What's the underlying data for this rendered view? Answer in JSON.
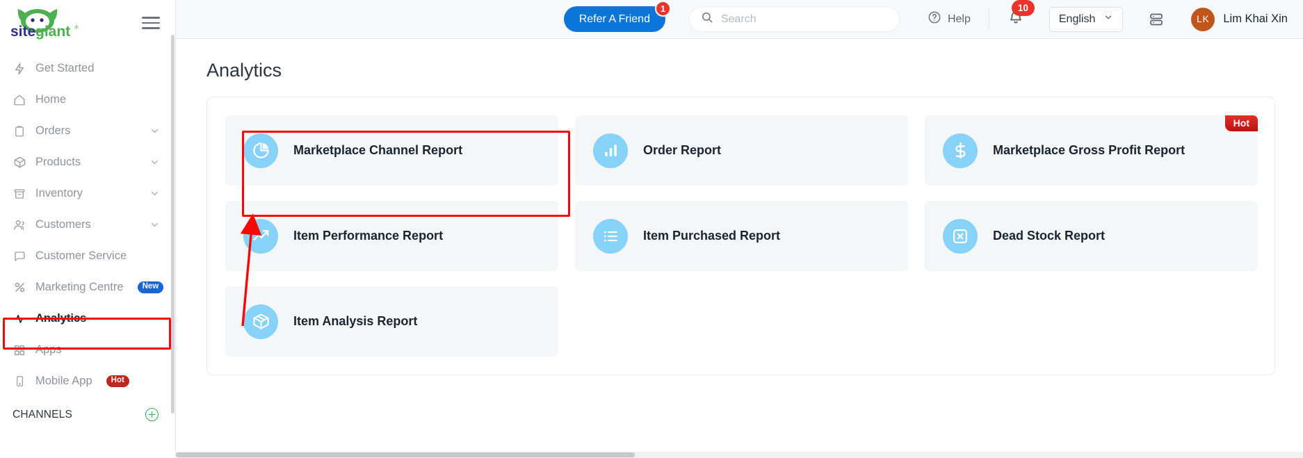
{
  "brand": {
    "name": "sitegiant",
    "registered_mark": "®"
  },
  "sidebar": {
    "menu_icon": "hamburger-icon",
    "items": [
      {
        "label": "Get Started",
        "icon": "lightning-icon",
        "chevron": false,
        "badge": null,
        "active": false
      },
      {
        "label": "Home",
        "icon": "home-icon",
        "chevron": false,
        "badge": null,
        "active": false
      },
      {
        "label": "Orders",
        "icon": "clipboard-icon",
        "chevron": true,
        "badge": null,
        "active": false
      },
      {
        "label": "Products",
        "icon": "box-icon",
        "chevron": true,
        "badge": null,
        "active": false
      },
      {
        "label": "Inventory",
        "icon": "archive-icon",
        "chevron": true,
        "badge": null,
        "active": false
      },
      {
        "label": "Customers",
        "icon": "users-icon",
        "chevron": true,
        "badge": null,
        "active": false
      },
      {
        "label": "Customer Service",
        "icon": "chat-icon",
        "chevron": false,
        "badge": null,
        "active": false
      },
      {
        "label": "Marketing Centre",
        "icon": "percent-icon",
        "chevron": false,
        "badge": "New",
        "active": false
      },
      {
        "label": "Analytics",
        "icon": "activity-icon",
        "chevron": false,
        "badge": null,
        "active": true
      },
      {
        "label": "Apps",
        "icon": "grid-icon",
        "chevron": false,
        "badge": null,
        "active": false
      },
      {
        "label": "Mobile App",
        "icon": "mobile-icon",
        "chevron": false,
        "badge": "Hot",
        "active": false
      }
    ],
    "channels_label": "CHANNELS",
    "channels_add_icon": "plus-circle-icon"
  },
  "topbar": {
    "refer_label": "Refer A Friend",
    "refer_badge": "1",
    "search_placeholder": "Search",
    "search_value": "",
    "search_icon": "search-icon",
    "help_label": "Help",
    "help_icon": "question-circle-icon",
    "bell_icon": "notification-icon",
    "bell_badge": "10",
    "language": "English",
    "language_chevron": "chevron-down-icon",
    "server_icon": "server-icon",
    "user_initials": "LK",
    "user_name": "Lim Khai Xin"
  },
  "main": {
    "page_title": "Analytics",
    "cards": [
      {
        "label": "Marketplace Channel Report",
        "icon": "pie-chart-icon",
        "tag": null,
        "highlighted": true
      },
      {
        "label": "Order Report",
        "icon": "bar-chart-icon",
        "tag": null,
        "highlighted": false
      },
      {
        "label": "Marketplace Gross Profit Report",
        "icon": "dollar-icon",
        "tag": "Hot",
        "highlighted": false
      },
      {
        "label": "Item Performance Report",
        "icon": "trending-up-icon",
        "tag": null,
        "highlighted": false
      },
      {
        "label": "Item Purchased Report",
        "icon": "list-icon",
        "tag": null,
        "highlighted": false
      },
      {
        "label": "Dead Stock Report",
        "icon": "x-square-icon",
        "tag": null,
        "highlighted": false
      },
      {
        "label": "Item Analysis Report",
        "icon": "package-icon",
        "tag": null,
        "highlighted": false
      }
    ]
  },
  "annotations": {
    "highlight_color": "#fb0606",
    "boxes": [
      "sidebar-analytics-item",
      "marketplace-channel-report-card"
    ],
    "arrow": "arrow-from-card-to-sidebar"
  }
}
